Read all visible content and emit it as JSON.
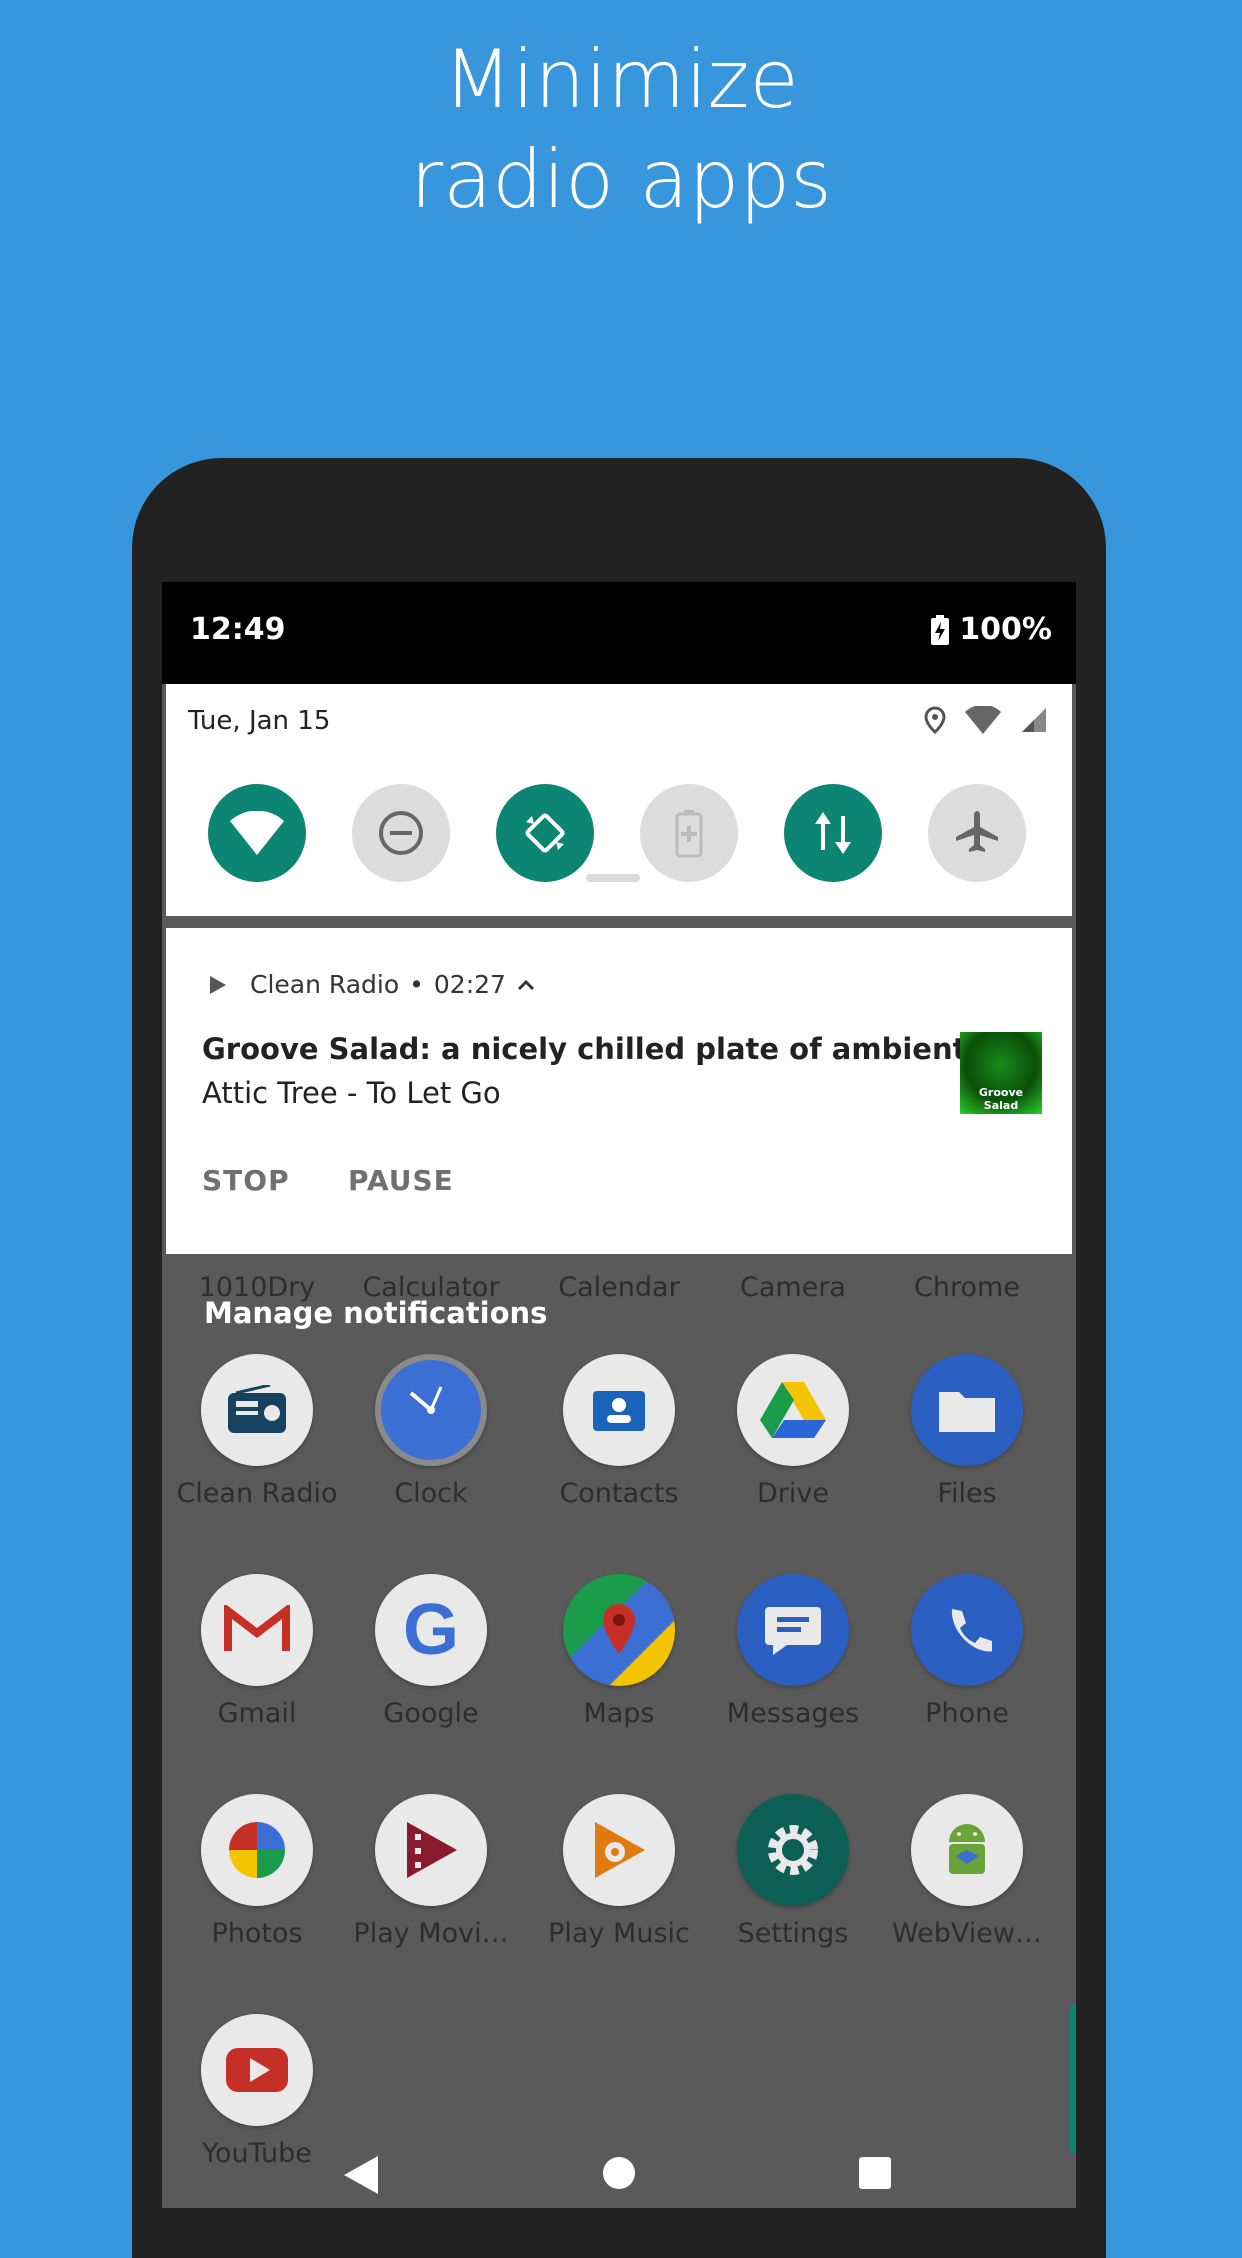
{
  "headline": {
    "line1": "Minimize",
    "line2": "radio apps"
  },
  "status_bar": {
    "time": "12:49",
    "battery": "100%"
  },
  "quick_settings": {
    "date": "Tue, Jan 15",
    "tiles": [
      {
        "name": "wifi",
        "state": "on"
      },
      {
        "name": "do-not-disturb",
        "state": "off"
      },
      {
        "name": "auto-rotate",
        "state": "on"
      },
      {
        "name": "battery-saver",
        "state": "off"
      },
      {
        "name": "mobile-data",
        "state": "on"
      },
      {
        "name": "airplane-mode",
        "state": "off"
      }
    ]
  },
  "notification": {
    "app": "Clean Radio",
    "time": "02:27",
    "title": "Groove Salad: a nicely chilled plate of ambient be..",
    "subtitle": "Attic Tree - To Let Go",
    "art_label": "Groove Salad",
    "actions": {
      "stop": "STOP",
      "pause": "PAUSE"
    }
  },
  "manage_label": "Manage notifications",
  "drawer": {
    "top_row_labels": [
      "1010Dry",
      "Calculator",
      "Calendar",
      "Camera",
      "Chrome"
    ],
    "apps": [
      {
        "label": "Clean Radio",
        "icon": "radio-icon"
      },
      {
        "label": "Clock",
        "icon": "clock-icon"
      },
      {
        "label": "Contacts",
        "icon": "contacts-icon"
      },
      {
        "label": "Drive",
        "icon": "drive-icon"
      },
      {
        "label": "Files",
        "icon": "folder-icon"
      },
      {
        "label": "Gmail",
        "icon": "gmail-icon"
      },
      {
        "label": "Google",
        "icon": "google-icon"
      },
      {
        "label": "Maps",
        "icon": "maps-icon"
      },
      {
        "label": "Messages",
        "icon": "messages-icon"
      },
      {
        "label": "Phone",
        "icon": "phone-icon"
      },
      {
        "label": "Photos",
        "icon": "photos-icon"
      },
      {
        "label": "Play Movi…",
        "icon": "play-movies-icon"
      },
      {
        "label": "Play Music",
        "icon": "play-music-icon"
      },
      {
        "label": "Settings",
        "icon": "settings-icon"
      },
      {
        "label": "WebView…",
        "icon": "webview-icon"
      },
      {
        "label": "YouTube",
        "icon": "youtube-icon"
      }
    ]
  },
  "colors": {
    "background": "#3897dc",
    "accent": "#0c8573"
  }
}
